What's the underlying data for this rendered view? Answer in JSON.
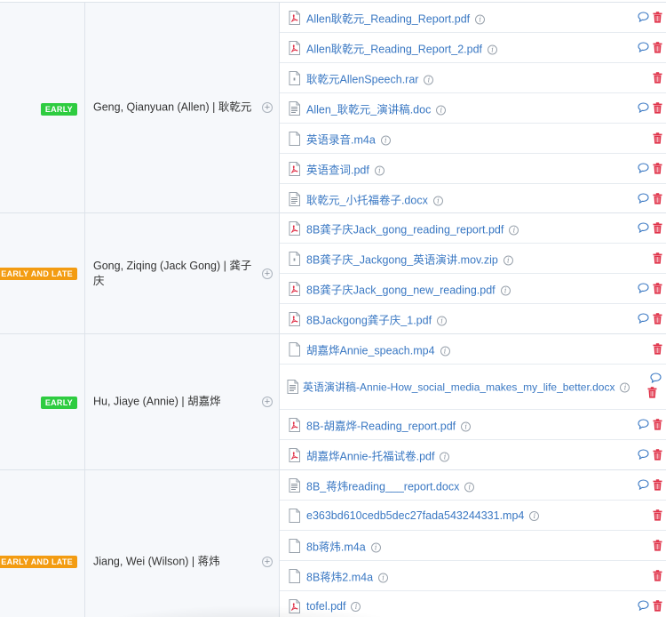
{
  "colors": {
    "link": "#3a78c3",
    "badge_early": "#2ecc40",
    "badge_early_late": "#f39c12",
    "trash": "#e0334a",
    "chat": "#3a78c3"
  },
  "students": [
    {
      "badge": "EARLY",
      "badge_color": "green",
      "name": "Geng, Qianyuan (Allen) | 耿乾元",
      "files": [
        {
          "name": "Allen耿乾元_Reading_Report.pdf",
          "type": "pdf",
          "info": true,
          "chat": true
        },
        {
          "name": "Allen耿乾元_Reading_Report_2.pdf",
          "type": "pdf",
          "info": true,
          "chat": true
        },
        {
          "name": "耿乾元AllenSpeech.rar",
          "type": "archive",
          "info": true,
          "chat": false
        },
        {
          "name": "Allen_耿乾元_演讲稿.doc",
          "type": "doc",
          "info": true,
          "chat": true
        },
        {
          "name": "英语录音.m4a",
          "type": "blank",
          "info": true,
          "chat": false
        },
        {
          "name": "英语查词.pdf",
          "type": "pdf",
          "info": true,
          "chat": true
        },
        {
          "name": "耿乾元_小托福卷子.docx",
          "type": "doc",
          "info": true,
          "chat": true
        }
      ]
    },
    {
      "badge": "EARLY AND LATE",
      "badge_color": "orange",
      "name": "Gong, Ziqing (Jack Gong) | 龚子庆",
      "files": [
        {
          "name": "8B龚子庆Jack_gong_reading_report.pdf",
          "type": "pdf",
          "info": true,
          "chat": true
        },
        {
          "name": "8B龚子庆_Jackgong_英语演讲.mov.zip",
          "type": "archive",
          "info": true,
          "chat": false
        },
        {
          "name": "8B龚子庆Jack_gong_new_reading.pdf",
          "type": "pdf",
          "info": true,
          "chat": true
        },
        {
          "name": "8BJackgong龚子庆_1.pdf",
          "type": "pdf",
          "info": true,
          "chat": true
        }
      ]
    },
    {
      "badge": "EARLY",
      "badge_color": "green",
      "name": "Hu, Jiaye (Annie) | 胡嘉烨",
      "files": [
        {
          "name": "胡嘉烨Annie_speach.mp4",
          "type": "blank",
          "info": true,
          "chat": false
        },
        {
          "name": "英语演讲稿-Annie-How_social_media_makes_my_life_better.docx",
          "type": "doc",
          "info": true,
          "chat": true
        },
        {
          "name": "8B-胡嘉烨-Reading_report.pdf",
          "type": "pdf",
          "info": true,
          "chat": true
        },
        {
          "name": "胡嘉烨Annie-托福试卷.pdf",
          "type": "pdf",
          "info": true,
          "chat": true
        }
      ]
    },
    {
      "badge": "EARLY AND LATE",
      "badge_color": "orange",
      "name": "Jiang, Wei (Wilson) | 蒋炜",
      "files": [
        {
          "name": "8B_蒋炜reading___report.docx",
          "type": "doc",
          "info": true,
          "chat": true
        },
        {
          "name": "e363bd610cedb5dec27fada543244331.mp4",
          "type": "blank",
          "info": true,
          "chat": false
        },
        {
          "name": "8b蒋炜.m4a",
          "type": "blank",
          "info": true,
          "chat": false
        },
        {
          "name": "8B蒋炜2.m4a",
          "type": "blank",
          "info": true,
          "chat": false
        },
        {
          "name": "tofel.pdf",
          "type": "pdf",
          "info": true,
          "chat": true
        }
      ]
    }
  ]
}
